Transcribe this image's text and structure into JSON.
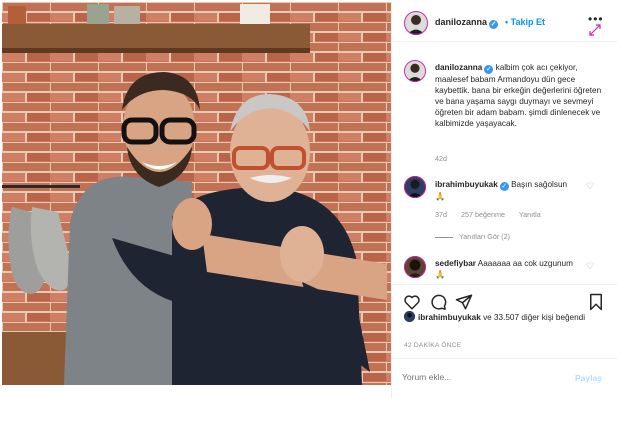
{
  "post": {
    "username": "danilozanna",
    "follow_label": "Takip Et",
    "more_label": "•••"
  },
  "caption": {
    "username": "danilozanna",
    "text": "kalbim çok acı çekiyor, maalesef babam Armandoyu dün gece kaybettik. bana bir erkeğin değerlerini öğreten ve bana yaşama saygı duymayı ve sevmeyi öğreten bir adam babam. şimdi dinlenecek ve kalbimizde yaşayacak.",
    "age": "42d"
  },
  "comments": [
    {
      "username": "ibrahimbuyukak",
      "text": "Başın sağolsun🙏",
      "age": "37d",
      "likes": "257 beğenme",
      "reply": "Yanıtla",
      "view_replies": "Yanıtları Gör (2)"
    },
    {
      "username": "sedefiybar",
      "text": "Aaaaaaa aa cok uzgunum🙏"
    }
  ],
  "likes": {
    "username": "ibrahimbuyukak",
    "rest": "ve 33.507 diğer kişi beğendi"
  },
  "time_ago": "42 DAKİKA ÖNCE",
  "add_comment": {
    "placeholder": "Yorum ekle...",
    "post_label": "Paylaş"
  },
  "colors": {
    "link_blue": "#0095f6",
    "verified_blue": "#3897f0",
    "muted": "#8e8e8e",
    "border": "#efefef"
  },
  "icons": [
    "verified-icon",
    "more-options-icon",
    "expand-icon",
    "heart-icon",
    "comment-icon",
    "share-icon",
    "bookmark-icon"
  ]
}
